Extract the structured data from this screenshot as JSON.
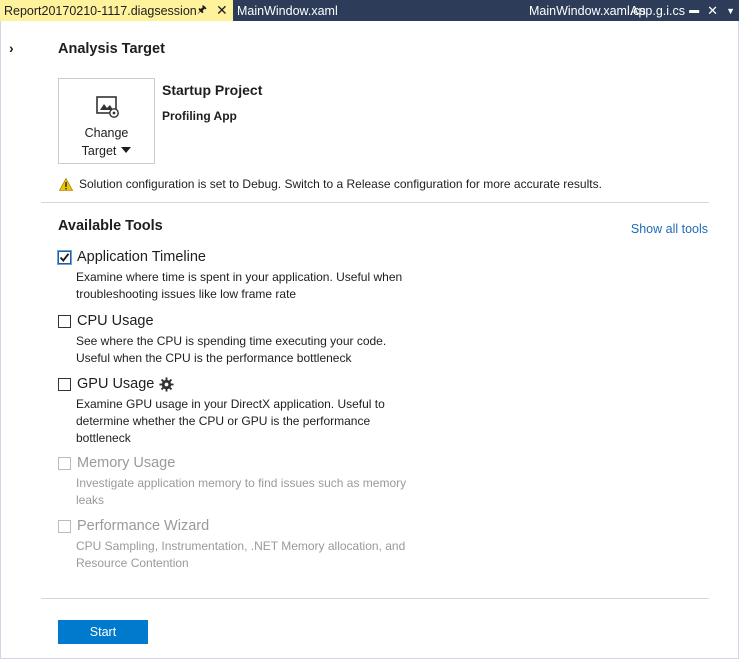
{
  "tabs": [
    {
      "label": "Report20170210-1117.diagsession",
      "active": true
    },
    {
      "label": "MainWindow.xaml"
    },
    {
      "label": "MainWindow.xaml.cs"
    },
    {
      "label": "App.g.i.cs"
    }
  ],
  "analysis_target": {
    "heading": "Analysis Target",
    "change_target_line1": "Change",
    "change_target_line2": "Target",
    "startup_title": "Startup Project",
    "startup_value": "Profiling App",
    "warning": "Solution configuration is set to Debug. Switch to a Release configuration for more accurate results."
  },
  "available_tools": {
    "heading": "Available Tools",
    "show_all": "Show all tools",
    "tools": [
      {
        "name": "Application Timeline",
        "desc": "Examine where time is spent in your application. Useful when troubleshooting issues like low frame rate",
        "checked": true,
        "enabled": true
      },
      {
        "name": "CPU Usage",
        "desc": "See where the CPU is spending time executing your code. Useful when the CPU is the performance bottleneck",
        "checked": false,
        "enabled": true
      },
      {
        "name": "GPU Usage",
        "desc": "Examine GPU usage in your DirectX application. Useful to determine whether the CPU or GPU is the performance bottleneck",
        "checked": false,
        "enabled": true
      },
      {
        "name": "Memory Usage",
        "desc": "Investigate application memory to find issues such as memory leaks",
        "checked": false,
        "enabled": false
      },
      {
        "name": "Performance Wizard",
        "desc": "CPU Sampling, Instrumentation, .NET Memory allocation, and Resource Contention",
        "checked": false,
        "enabled": false
      }
    ]
  },
  "start_label": "Start",
  "icons": {
    "tab_pin": "pin-icon",
    "tab_close": "close-icon",
    "expander": "chevron-right-icon",
    "change_target": "target-settings-icon",
    "warning": "warning-icon",
    "gpu_settings": "gear-icon"
  },
  "colors": {
    "tabbar": "#2d3c58",
    "active_tab": "#fff29d",
    "link": "#1e6bb8",
    "start_button": "#007acc"
  }
}
